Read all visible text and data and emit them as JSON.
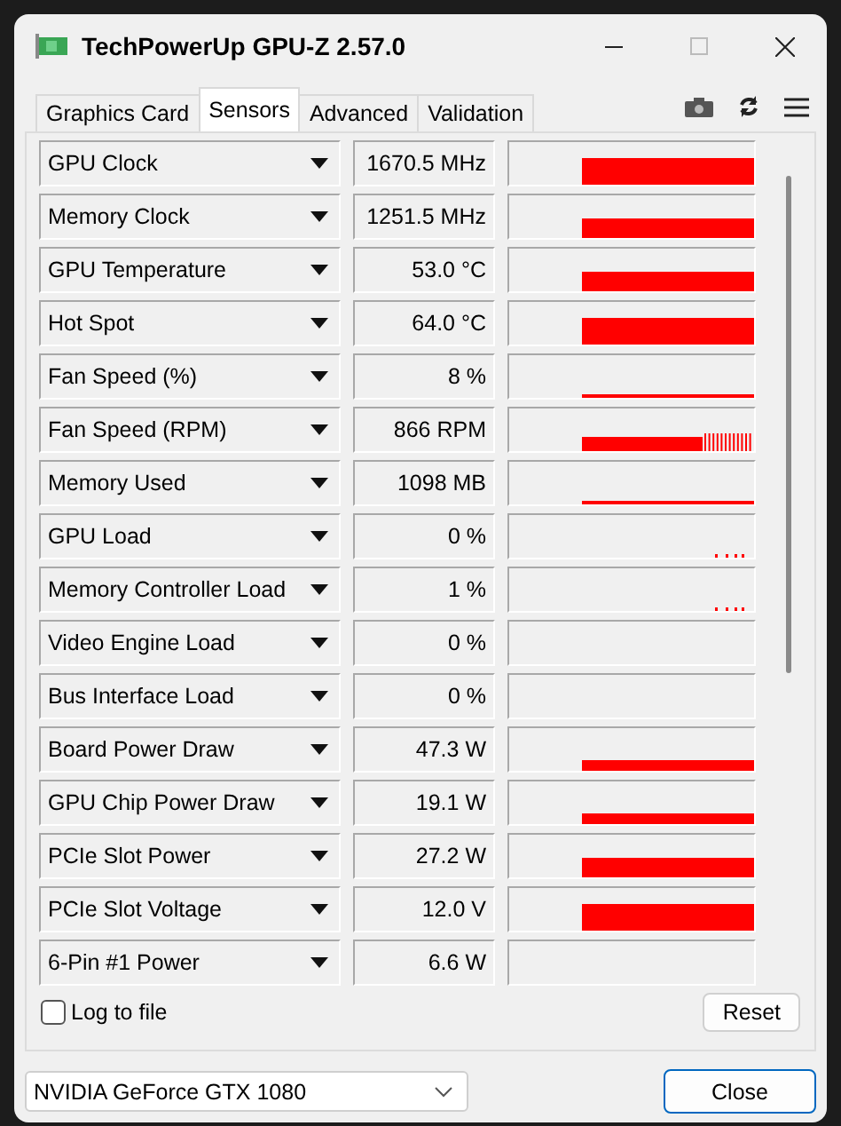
{
  "window": {
    "title": "TechPowerUp GPU-Z 2.57.0"
  },
  "tabs": [
    {
      "label": "Graphics Card",
      "selected": false
    },
    {
      "label": "Sensors",
      "selected": true
    },
    {
      "label": "Advanced",
      "selected": false
    },
    {
      "label": "Validation",
      "selected": false
    }
  ],
  "sensors": [
    {
      "name": "GPU Clock",
      "reading": "1670.5 MHz",
      "kind": "tall"
    },
    {
      "name": "Memory Clock",
      "reading": "1251.5 MHz",
      "kind": "medium"
    },
    {
      "name": "GPU Temperature",
      "reading": "53.0 °C",
      "kind": "medium"
    },
    {
      "name": "Hot Spot",
      "reading": "64.0 °C",
      "kind": "tall"
    },
    {
      "name": "Fan Speed (%)",
      "reading": "8 %",
      "kind": "thin"
    },
    {
      "name": "Fan Speed (RPM)",
      "reading": "866 RPM",
      "kind": "spiky"
    },
    {
      "name": "Memory Used",
      "reading": "1098 MB",
      "kind": "thin"
    },
    {
      "name": "GPU Load",
      "reading": "0 %",
      "kind": "sparse"
    },
    {
      "name": "Memory Controller Load",
      "reading": "1 %",
      "kind": "sparse"
    },
    {
      "name": "Video Engine Load",
      "reading": "0 %",
      "kind": "empty"
    },
    {
      "name": "Bus Interface Load",
      "reading": "0 %",
      "kind": "empty"
    },
    {
      "name": "Board Power Draw",
      "reading": "47.3 W",
      "kind": "short"
    },
    {
      "name": "GPU Chip Power Draw",
      "reading": "19.1 W",
      "kind": "short"
    },
    {
      "name": "PCIe Slot Power",
      "reading": "27.2 W",
      "kind": "medium"
    },
    {
      "name": "PCIe Slot Voltage",
      "reading": "12.0 V",
      "kind": "tall"
    },
    {
      "name": "6-Pin #1 Power",
      "reading": "6.6 W",
      "kind": "empty"
    }
  ],
  "log_to_file": {
    "label": "Log to file",
    "checked": false
  },
  "reset_button": "Reset",
  "gpu_select": {
    "value": "NVIDIA GeForce GTX 1080"
  },
  "close_button": "Close"
}
